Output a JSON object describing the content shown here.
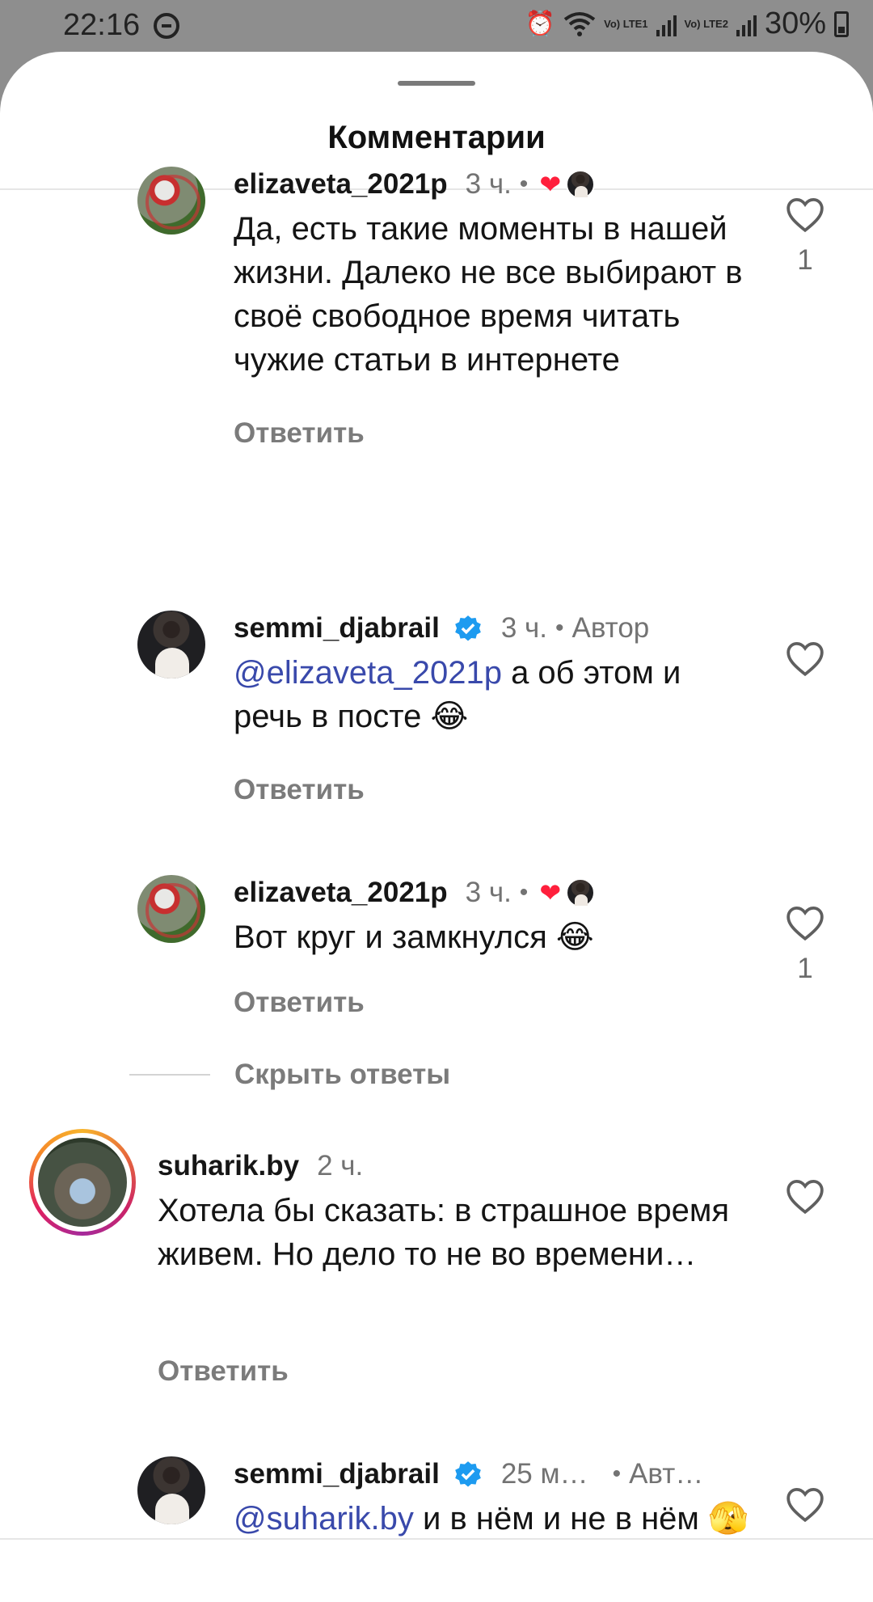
{
  "status_bar": {
    "time": "22:16",
    "sim1": "Vo) LTE1",
    "sim2": "Vo) LTE2",
    "battery": "30%",
    "icons": [
      "dnd-icon",
      "alarm-icon",
      "wifi-icon",
      "signal-icon",
      "battery-icon"
    ]
  },
  "sheet": {
    "title": "Комментарии"
  },
  "comments": [
    {
      "username": "elizaveta_2021p",
      "time": "3 ч.",
      "text": "Да, есть такие моменты в нашей жизни. Далеко не все выбирают в своё свободное время читать чужие статьи в интернете",
      "reply": "Ответить",
      "likes": "1",
      "liked_by_author": true
    },
    {
      "username": "semmi_djabrail",
      "verified": true,
      "time": "3 ч.",
      "author_label": "Автор",
      "mention": "@elizaveta_2021p",
      "text": " а об этом и речь в посте 😂",
      "reply": "Ответить"
    },
    {
      "username": "elizaveta_2021p",
      "time": "3 ч.",
      "text": "Вот круг и замкнулся 😂",
      "reply": "Ответить",
      "likes": "1",
      "liked_by_author": true
    },
    {
      "username": "suharik.by",
      "time": "2 ч.",
      "text": "Хотела бы сказать: в страшное время живем. Но дело то не во времени…",
      "reply": "Ответить"
    },
    {
      "username": "semmi_djabrail",
      "verified": true,
      "time": "25 м…",
      "author_label": "Авт…",
      "mention": "@suharik.by",
      "text": " и в нём и не в нём 🫣"
    }
  ],
  "hide_replies": "Скрыть ответы",
  "colors": {
    "mention": "#3949ab",
    "verified": "#1d9bf0",
    "liked_heart": "#ff1f3c",
    "muted": "#737373"
  }
}
